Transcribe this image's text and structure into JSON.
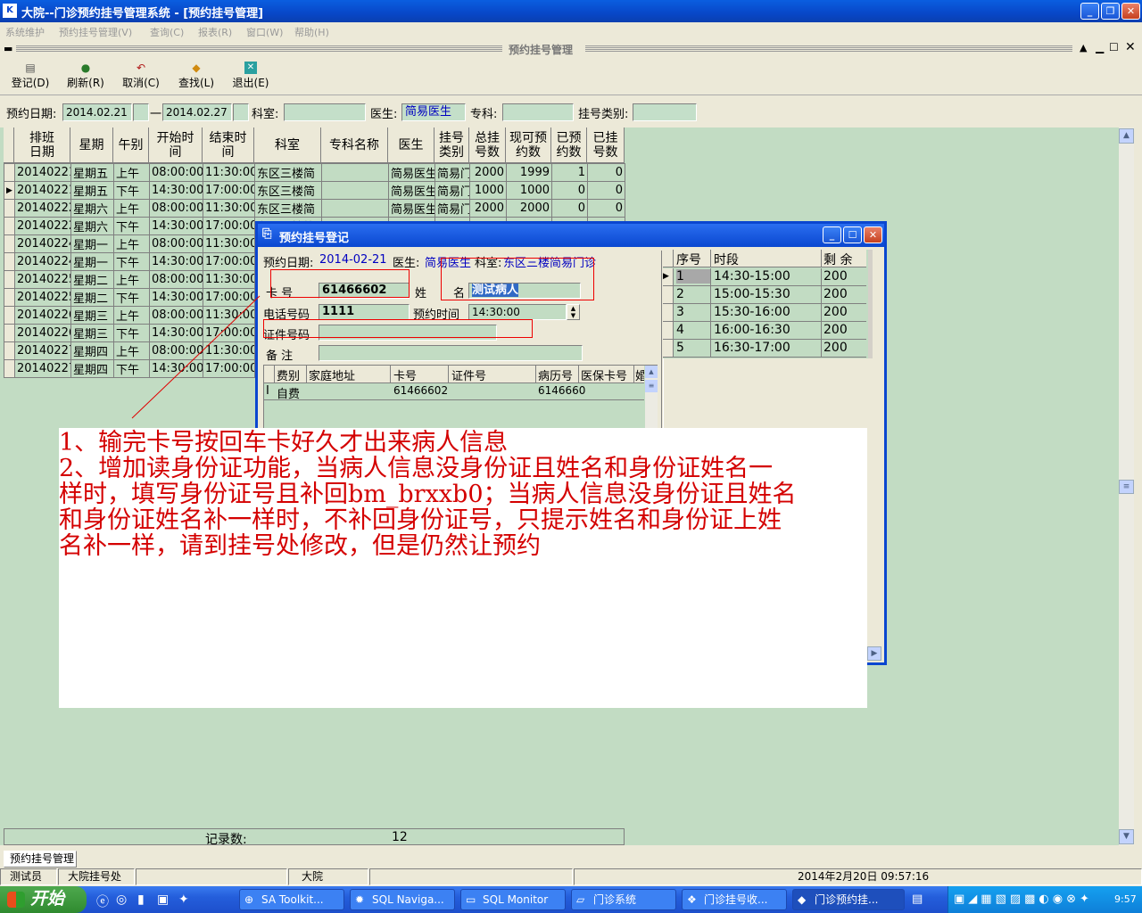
{
  "window": {
    "title": "大院--门诊预约挂号管理系统 - [预约挂号管理]",
    "icon": "app-icon"
  },
  "menu": [
    "系统维护",
    "预约挂号管理(V)",
    "查询(C)",
    "报表(R)",
    "窗口(W)",
    "帮助(H)"
  ],
  "mdi_title": "预约挂号管理",
  "toolbar": [
    {
      "label": "登记(D)",
      "icon": "register-icon"
    },
    {
      "label": "刷新(R)",
      "icon": "refresh-icon"
    },
    {
      "label": "取消(C)",
      "icon": "cancel-icon"
    },
    {
      "label": "查找(L)",
      "icon": "find-icon"
    },
    {
      "label": "退出(E)",
      "icon": "exit-icon"
    }
  ],
  "filter": {
    "date_label": "预约日期:",
    "date_from": "2014.02.21",
    "sep": "一",
    "date_to": "2014.02.27",
    "dept_label": "科室:",
    "dept": "",
    "doctor_label": "医生:",
    "doctor": "简易医生",
    "special_label": "专科:",
    "special": "",
    "type_label": "挂号类别:",
    "type": ""
  },
  "grid": {
    "columns": [
      "排班\n日期",
      "星期",
      "午别",
      "开始时\n间",
      "结束时\n间",
      "科室",
      "专科名称",
      "医生",
      "挂号\n类别",
      "总挂\n号数",
      "现可预\n约数",
      "已预\n约数",
      "已挂\n号数"
    ],
    "rows": [
      [
        "20140221",
        "星期五",
        "上午",
        "08:00:00",
        "11:30:00",
        "东区三楼简",
        "",
        "简易医生",
        "简易门",
        "2000",
        "1999",
        "1",
        "0"
      ],
      [
        "20140221",
        "星期五",
        "下午",
        "14:30:00",
        "17:00:00",
        "东区三楼简",
        "",
        "简易医生",
        "简易门",
        "1000",
        "1000",
        "0",
        "0"
      ],
      [
        "20140222",
        "星期六",
        "上午",
        "08:00:00",
        "11:30:00",
        "东区三楼简",
        "",
        "简易医生",
        "简易门",
        "2000",
        "2000",
        "0",
        "0"
      ],
      [
        "20140222",
        "星期六",
        "下午",
        "14:30:00",
        "17:00:00",
        "东区三楼简",
        "",
        "",
        "",
        "",
        "",
        "",
        ""
      ],
      [
        "20140224",
        "星期一",
        "上午",
        "08:00:00",
        "11:30:00",
        "",
        "",
        "",
        "",
        "",
        "",
        "",
        ""
      ],
      [
        "20140224",
        "星期一",
        "下午",
        "14:30:00",
        "17:00:00",
        "",
        "",
        "",
        "",
        "",
        "",
        "",
        ""
      ],
      [
        "20140225",
        "星期二",
        "上午",
        "08:00:00",
        "11:30:00",
        "",
        "",
        "",
        "",
        "",
        "",
        "",
        ""
      ],
      [
        "20140225",
        "星期二",
        "下午",
        "14:30:00",
        "17:00:00",
        "",
        "",
        "",
        "",
        "",
        "",
        "",
        ""
      ],
      [
        "20140226",
        "星期三",
        "上午",
        "08:00:00",
        "11:30:00",
        "",
        "",
        "",
        "",
        "",
        "",
        "",
        ""
      ],
      [
        "20140226",
        "星期三",
        "下午",
        "14:30:00",
        "17:00:00",
        "",
        "",
        "",
        "",
        "",
        "",
        "",
        ""
      ],
      [
        "20140227",
        "星期四",
        "上午",
        "08:00:00",
        "11:30:00",
        "",
        "",
        "",
        "",
        "",
        "",
        "",
        ""
      ],
      [
        "20140227",
        "星期四",
        "下午",
        "14:30:00",
        "17:00:00",
        "",
        "",
        "",
        "",
        "",
        "",
        "",
        ""
      ]
    ],
    "selected_row": 1,
    "footer_label": "记录数:",
    "footer_count": "12"
  },
  "dialog": {
    "title": "预约挂号登记",
    "date_label": "预约日期:",
    "date": "2014-02-21",
    "doctor_label": "医生:",
    "doctor": "简易医生",
    "dept_label": "科室:",
    "dept": "东区三楼简易门诊",
    "card_label": "卡    号",
    "card": "61466602",
    "name_label_1": "姓",
    "name_label_2": "名",
    "name": "测试病人",
    "phone_label": "电话号码",
    "phone": "1111",
    "time_label": "预约时间",
    "time": "14:30:00",
    "id_label": "证件号码",
    "id": "",
    "note_label": "备    注",
    "note": "",
    "sub_columns": [
      "费别",
      "家庭地址",
      "卡号",
      "证件号",
      "病历号",
      "医保卡号",
      "婚"
    ],
    "sub_rows": [
      [
        "自费",
        "",
        "61466602",
        "",
        "6146660",
        ""
      ]
    ],
    "slot_columns": [
      "序号",
      "时段",
      "剩 余"
    ],
    "slots": [
      [
        "1",
        "14:30-15:00",
        "200"
      ],
      [
        "2",
        "15:00-15:30",
        "200"
      ],
      [
        "3",
        "15:30-16:00",
        "200"
      ],
      [
        "4",
        "16:00-16:30",
        "200"
      ],
      [
        "5",
        "16:30-17:00",
        "200"
      ]
    ]
  },
  "annotation": [
    "1、输完卡号按回车卡好久才出来病人信息",
    "2、增加读身份证功能，当病人信息没身份证且姓名和身份证姓名一",
    "样时，填写身份证号且补回bm_brxxb0；当病人信息没身份证且姓名",
    "和身份证姓名补一样时，不补回身份证号，只提示姓名和身份证上姓",
    "名补一样，请到挂号处修改，但是仍然让预约"
  ],
  "bottom_tab": "预约挂号管理",
  "status": {
    "user": "测试员",
    "place": "大院挂号处",
    "hospital": "大院",
    "datetime": "2014年2月20日  09:57:16"
  },
  "taskbar": {
    "start": "开始",
    "tasks": [
      "SA Toolkit...",
      "SQL Naviga...",
      "SQL Monitor",
      "门诊系统",
      "门诊挂号收...",
      "门诊预约挂..."
    ],
    "clock": "9:57"
  },
  "colors": {
    "grid_bg": "#c2dcc3",
    "xp_blue": "#0a5ee0",
    "annotation_red": "#d40000"
  }
}
